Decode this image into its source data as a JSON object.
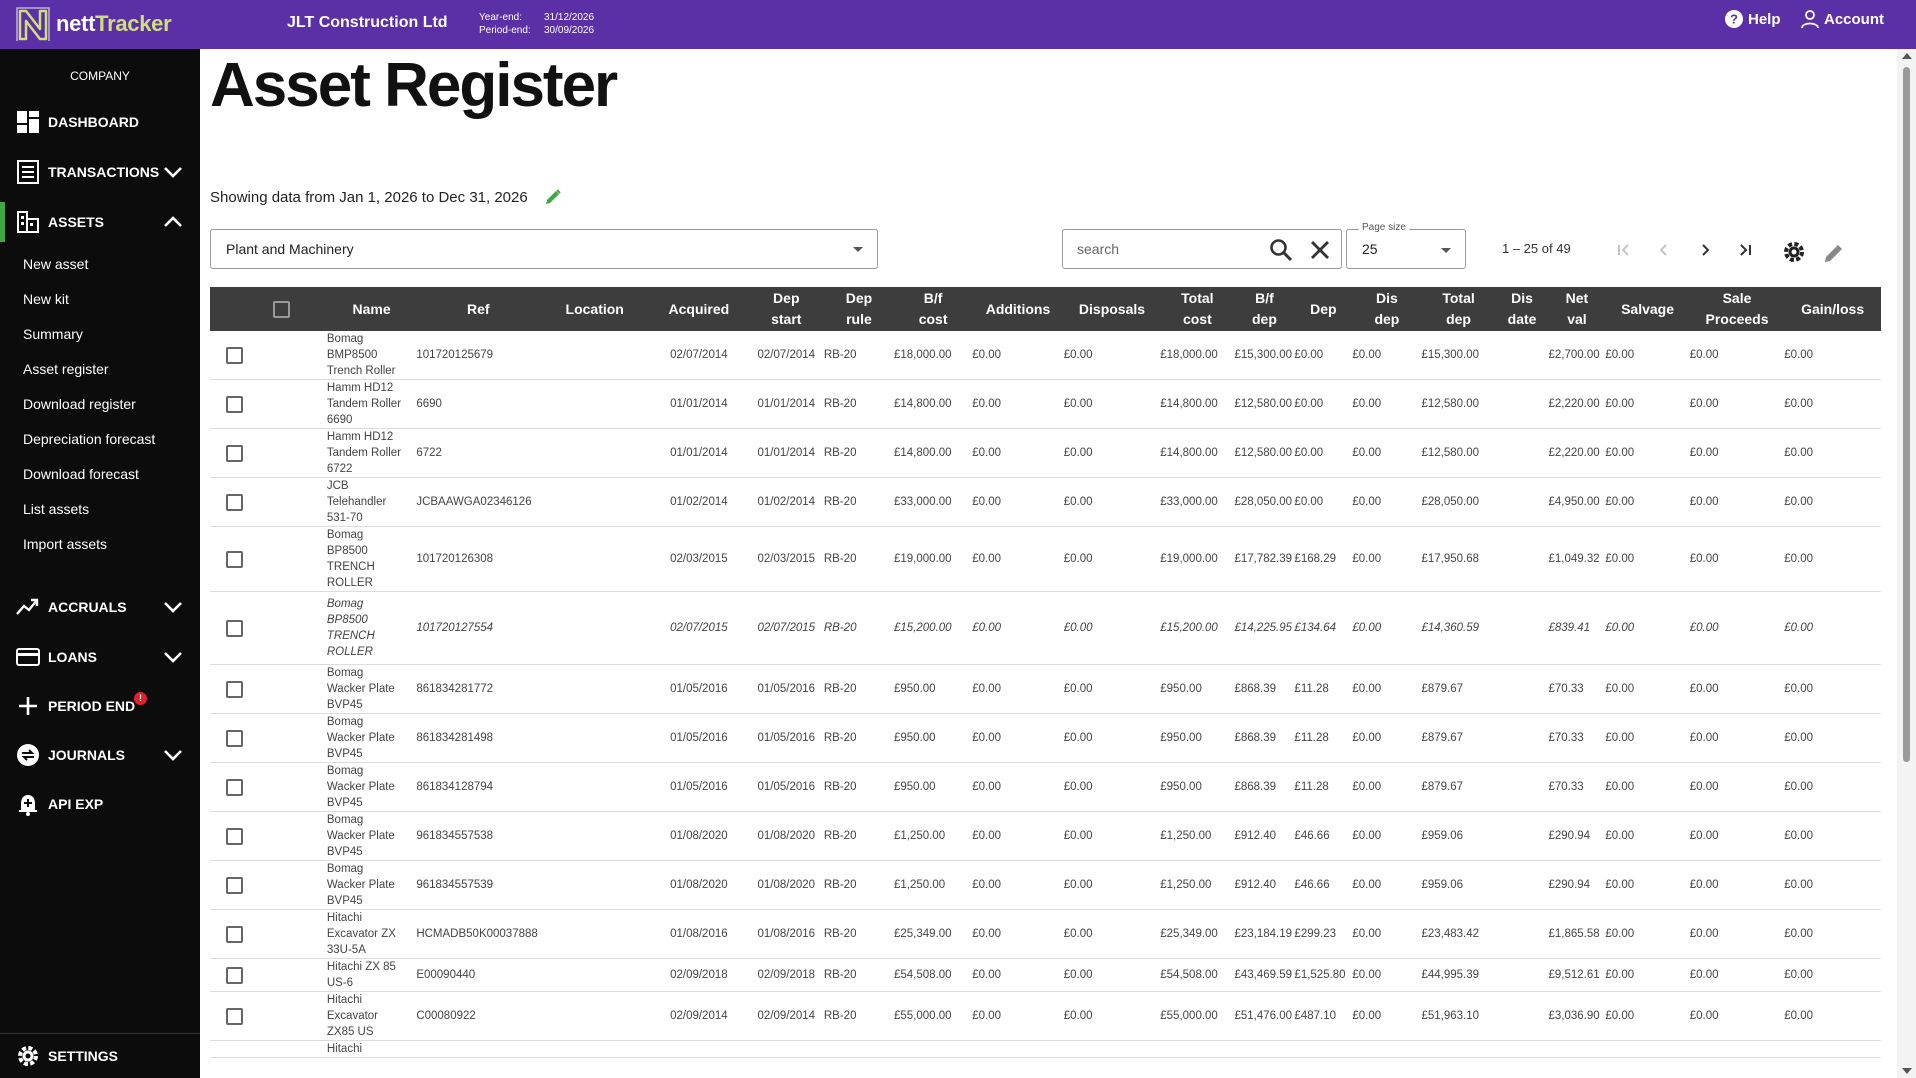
{
  "app": {
    "logo_brand_prefix": "nett",
    "logo_brand_suffix": "Tracker",
    "company_name": "JLT Construction Ltd",
    "year_end_label": "Year-end:",
    "year_end_value": "31/12/2026",
    "period_end_label": "Period-end:",
    "period_end_value": "30/09/2026",
    "help_label": "Help",
    "account_label": "Account",
    "brand_color": "#5b2fa6",
    "accent_color": "#3ea843",
    "alert_color": "#e0212b"
  },
  "sidebar": {
    "company_label": "COMPANY",
    "dashboard": "DASHBOARD",
    "transactions": "TRANSACTIONS",
    "assets": "ASSETS",
    "asset_items": [
      "New asset",
      "New kit",
      "Summary",
      "Asset register",
      "Download register",
      "Depreciation forecast",
      "Download forecast",
      "List assets",
      "Import assets"
    ],
    "accruals": "ACCRUALS",
    "loans": "LOANS",
    "period_end": "PERIOD END",
    "period_end_badge": "!",
    "journals": "JOURNALS",
    "api_exp": "API EXP",
    "settings": "SETTINGS"
  },
  "main": {
    "title": "Asset Register",
    "showing_text": "Showing data from Jan 1, 2026 to Dec 31, 2026",
    "category_value": "Plant and Machinery",
    "search_placeholder": "search",
    "page_size_label": "Page size",
    "page_size_value": "25",
    "range_text": "1 – 25 of 49"
  },
  "table": {
    "headers": [
      [
        "Name"
      ],
      [
        "Ref"
      ],
      [
        "Location"
      ],
      [
        "Acquired"
      ],
      [
        "Dep",
        "start"
      ],
      [
        "Dep",
        "rule"
      ],
      [
        "B/f",
        "cost"
      ],
      [
        "Additions"
      ],
      [
        "Disposals"
      ],
      [
        "Total",
        "cost"
      ],
      [
        "B/f",
        "dep"
      ],
      [
        "Dep"
      ],
      [
        "Dis",
        "dep"
      ],
      [
        "Total",
        "dep"
      ],
      [
        "Dis",
        "date"
      ],
      [
        "Net",
        "val"
      ],
      [
        "Salvage"
      ],
      [
        "Sale",
        "Proceeds"
      ],
      [
        "Gain/loss"
      ]
    ],
    "rows": [
      {
        "name": [
          "Bomag",
          "BMP8500",
          "Trench Roller"
        ],
        "ref": "101720125679",
        "location": "",
        "acquired": "02/07/2014",
        "dep_start": "02/07/2014",
        "dep_rule": "RB-20",
        "bf_cost": "£18,000.00",
        "additions": "£0.00",
        "disposals": "£0.00",
        "total_cost": "£18,000.00",
        "bf_dep": "£15,300.00",
        "dep": "£0.00",
        "dis_dep": "£0.00",
        "total_dep": "£15,300.00",
        "dis_date": "",
        "net_val": "£2,700.00",
        "salvage": "£0.00",
        "sale_proceeds": "£0.00",
        "gain_loss": "£0.00"
      },
      {
        "name": [
          "Hamm HD12",
          "Tandem Roller",
          "6690"
        ],
        "ref": "6690",
        "location": "",
        "acquired": "01/01/2014",
        "dep_start": "01/01/2014",
        "dep_rule": "RB-20",
        "bf_cost": "£14,800.00",
        "additions": "£0.00",
        "disposals": "£0.00",
        "total_cost": "£14,800.00",
        "bf_dep": "£12,580.00",
        "dep": "£0.00",
        "dis_dep": "£0.00",
        "total_dep": "£12,580.00",
        "dis_date": "",
        "net_val": "£2,220.00",
        "salvage": "£0.00",
        "sale_proceeds": "£0.00",
        "gain_loss": "£0.00"
      },
      {
        "name": [
          "Hamm HD12",
          "Tandem Roller",
          "6722"
        ],
        "ref": "6722",
        "location": "",
        "acquired": "01/01/2014",
        "dep_start": "01/01/2014",
        "dep_rule": "RB-20",
        "bf_cost": "£14,800.00",
        "additions": "£0.00",
        "disposals": "£0.00",
        "total_cost": "£14,800.00",
        "bf_dep": "£12,580.00",
        "dep": "£0.00",
        "dis_dep": "£0.00",
        "total_dep": "£12,580.00",
        "dis_date": "",
        "net_val": "£2,220.00",
        "salvage": "£0.00",
        "sale_proceeds": "£0.00",
        "gain_loss": "£0.00"
      },
      {
        "name": [
          "JCB",
          "Telehandler",
          "531-70"
        ],
        "ref": "JCBAAWGA02346126",
        "location": "",
        "acquired": "01/02/2014",
        "dep_start": "01/02/2014",
        "dep_rule": "RB-20",
        "bf_cost": "£33,000.00",
        "additions": "£0.00",
        "disposals": "£0.00",
        "total_cost": "£33,000.00",
        "bf_dep": "£28,050.00",
        "dep": "£0.00",
        "dis_dep": "£0.00",
        "total_dep": "£28,050.00",
        "dis_date": "",
        "net_val": "£4,950.00",
        "salvage": "£0.00",
        "sale_proceeds": "£0.00",
        "gain_loss": "£0.00"
      },
      {
        "name": [
          "Bomag",
          "BP8500",
          "TRENCH",
          "ROLLER"
        ],
        "ref": "101720126308",
        "location": "",
        "acquired": "02/03/2015",
        "dep_start": "02/03/2015",
        "dep_rule": "RB-20",
        "bf_cost": "£19,000.00",
        "additions": "£0.00",
        "disposals": "£0.00",
        "total_cost": "£19,000.00",
        "bf_dep": "£17,782.39",
        "dep": "£168.29",
        "dis_dep": "£0.00",
        "total_dep": "£17,950.68",
        "dis_date": "",
        "net_val": "£1,049.32",
        "salvage": "£0.00",
        "sale_proceeds": "£0.00",
        "gain_loss": "£0.00"
      },
      {
        "name": [
          "Bomag",
          "BP8500",
          "TRENCH",
          "ROLLER"
        ],
        "expandable": true,
        "italic": true,
        "ref": "101720127554",
        "location": "",
        "acquired": "02/07/2015",
        "dep_start": "02/07/2015",
        "dep_rule": "RB-20",
        "bf_cost": "£15,200.00",
        "additions": "£0.00",
        "disposals": "£0.00",
        "total_cost": "£15,200.00",
        "bf_dep": "£14,225.95",
        "dep": "£134.64",
        "dis_dep": "£0.00",
        "total_dep": "£14,360.59",
        "dis_date": "",
        "net_val": "£839.41",
        "salvage": "£0.00",
        "sale_proceeds": "£0.00",
        "gain_loss": "£0.00"
      },
      {
        "name": [
          "Bomag",
          "Wacker Plate",
          "BVP45"
        ],
        "ref": "861834281772",
        "location": "",
        "acquired": "01/05/2016",
        "dep_start": "01/05/2016",
        "dep_rule": "RB-20",
        "bf_cost": "£950.00",
        "additions": "£0.00",
        "disposals": "£0.00",
        "total_cost": "£950.00",
        "bf_dep": "£868.39",
        "dep": "£11.28",
        "dis_dep": "£0.00",
        "total_dep": "£879.67",
        "dis_date": "",
        "net_val": "£70.33",
        "salvage": "£0.00",
        "sale_proceeds": "£0.00",
        "gain_loss": "£0.00"
      },
      {
        "name": [
          "Bomag",
          "Wacker Plate",
          "BVP45"
        ],
        "ref": "861834281498",
        "location": "",
        "acquired": "01/05/2016",
        "dep_start": "01/05/2016",
        "dep_rule": "RB-20",
        "bf_cost": "£950.00",
        "additions": "£0.00",
        "disposals": "£0.00",
        "total_cost": "£950.00",
        "bf_dep": "£868.39",
        "dep": "£11.28",
        "dis_dep": "£0.00",
        "total_dep": "£879.67",
        "dis_date": "",
        "net_val": "£70.33",
        "salvage": "£0.00",
        "sale_proceeds": "£0.00",
        "gain_loss": "£0.00"
      },
      {
        "name": [
          "Bomag",
          "Wacker Plate",
          "BVP45"
        ],
        "ref": "861834128794",
        "location": "",
        "acquired": "01/05/2016",
        "dep_start": "01/05/2016",
        "dep_rule": "RB-20",
        "bf_cost": "£950.00",
        "additions": "£0.00",
        "disposals": "£0.00",
        "total_cost": "£950.00",
        "bf_dep": "£868.39",
        "dep": "£11.28",
        "dis_dep": "£0.00",
        "total_dep": "£879.67",
        "dis_date": "",
        "net_val": "£70.33",
        "salvage": "£0.00",
        "sale_proceeds": "£0.00",
        "gain_loss": "£0.00"
      },
      {
        "name": [
          "Bomag",
          "Wacker Plate",
          "BVP45"
        ],
        "ref": "961834557538",
        "location": "",
        "acquired": "01/08/2020",
        "dep_start": "01/08/2020",
        "dep_rule": "RB-20",
        "bf_cost": "£1,250.00",
        "additions": "£0.00",
        "disposals": "£0.00",
        "total_cost": "£1,250.00",
        "bf_dep": "£912.40",
        "dep": "£46.66",
        "dis_dep": "£0.00",
        "total_dep": "£959.06",
        "dis_date": "",
        "net_val": "£290.94",
        "salvage": "£0.00",
        "sale_proceeds": "£0.00",
        "gain_loss": "£0.00"
      },
      {
        "name": [
          "Bomag",
          "Wacker Plate",
          "BVP45"
        ],
        "ref": "961834557539",
        "location": "",
        "acquired": "01/08/2020",
        "dep_start": "01/08/2020",
        "dep_rule": "RB-20",
        "bf_cost": "£1,250.00",
        "additions": "£0.00",
        "disposals": "£0.00",
        "total_cost": "£1,250.00",
        "bf_dep": "£912.40",
        "dep": "£46.66",
        "dis_dep": "£0.00",
        "total_dep": "£959.06",
        "dis_date": "",
        "net_val": "£290.94",
        "salvage": "£0.00",
        "sale_proceeds": "£0.00",
        "gain_loss": "£0.00"
      },
      {
        "name": [
          "Hitachi",
          "Excavator ZX",
          "33U-5A"
        ],
        "ref": "HCMADB50K00037888",
        "location": "",
        "acquired": "01/08/2016",
        "dep_start": "01/08/2016",
        "dep_rule": "RB-20",
        "bf_cost": "£25,349.00",
        "additions": "£0.00",
        "disposals": "£0.00",
        "total_cost": "£25,349.00",
        "bf_dep": "£23,184.19",
        "dep": "£299.23",
        "dis_dep": "£0.00",
        "total_dep": "£23,483.42",
        "dis_date": "",
        "net_val": "£1,865.58",
        "salvage": "£0.00",
        "sale_proceeds": "£0.00",
        "gain_loss": "£0.00"
      },
      {
        "name": [
          "Hitachi ZX 85",
          "US-6"
        ],
        "ref": "E00090440",
        "location": "",
        "acquired": "02/09/2018",
        "dep_start": "02/09/2018",
        "dep_rule": "RB-20",
        "bf_cost": "£54,508.00",
        "additions": "£0.00",
        "disposals": "£0.00",
        "total_cost": "£54,508.00",
        "bf_dep": "£43,469.59",
        "dep": "£1,525.80",
        "dis_dep": "£0.00",
        "total_dep": "£44,995.39",
        "dis_date": "",
        "net_val": "£9,512.61",
        "salvage": "£0.00",
        "sale_proceeds": "£0.00",
        "gain_loss": "£0.00"
      },
      {
        "name": [
          "Hitachi",
          "Excavator",
          "ZX85 US"
        ],
        "ref": "C00080922",
        "location": "",
        "acquired": "02/09/2014",
        "dep_start": "02/09/2014",
        "dep_rule": "RB-20",
        "bf_cost": "£55,000.00",
        "additions": "£0.00",
        "disposals": "£0.00",
        "total_cost": "£55,000.00",
        "bf_dep": "£51,476.00",
        "dep": "£487.10",
        "dis_dep": "£0.00",
        "total_dep": "£51,963.10",
        "dis_date": "",
        "net_val": "£3,036.90",
        "salvage": "£0.00",
        "sale_proceeds": "£0.00",
        "gain_loss": "£0.00"
      },
      {
        "name": [
          "Hitachi"
        ],
        "ref": "",
        "location": "",
        "acquired": "",
        "dep_start": "",
        "dep_rule": "",
        "bf_cost": "",
        "additions": "",
        "disposals": "",
        "total_cost": "",
        "bf_dep": "",
        "dep": "",
        "dis_dep": "",
        "total_dep": "",
        "dis_date": "",
        "net_val": "",
        "salvage": "",
        "sale_proceeds": "",
        "gain_loss": ""
      }
    ]
  }
}
